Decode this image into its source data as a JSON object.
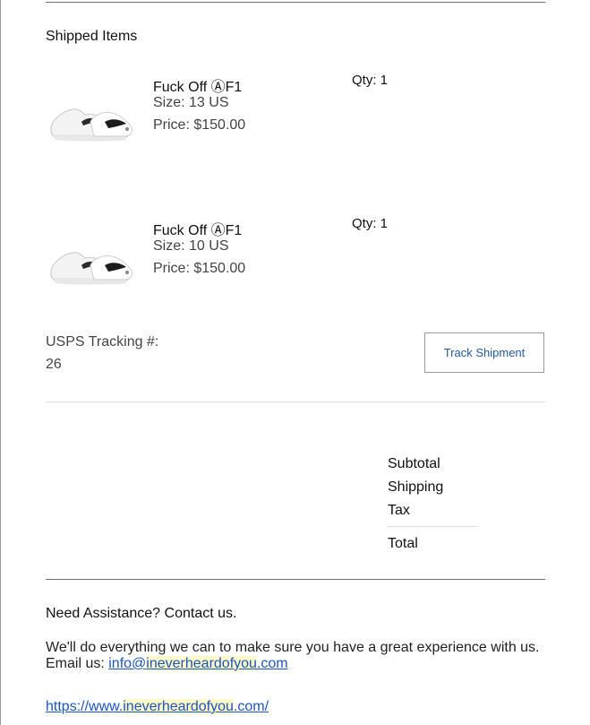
{
  "shipped": {
    "title": "Shipped Items",
    "items": [
      {
        "name": "Fuck Off ⒶF1",
        "size": "Size: 13 US",
        "price": "Price: $150.00",
        "qty": "Qty: 1",
        "image_icon": "sneaker-image"
      },
      {
        "name": "Fuck Off ⒶF1",
        "size": "Size: 10 US",
        "price": "Price: $150.00",
        "qty": "Qty: 1",
        "image_icon": "sneaker-image"
      }
    ]
  },
  "tracking": {
    "label": "USPS Tracking #:",
    "number": "26",
    "button_label": "Track Shipment"
  },
  "summary": {
    "subtotal_label": "Subtotal",
    "shipping_label": "Shipping",
    "tax_label": "Tax",
    "total_label": "Total"
  },
  "assistance": {
    "title": "Need Assistance? Contact us.",
    "body": "We'll do everything we can to make sure you have a great experience with us.",
    "email_prefix": "Email us: ",
    "email_part1": "info@",
    "email_part2": "ineverheardofyou",
    "email_part3": ".com",
    "website_part1": "https://www.",
    "website_part2": "ineverheardofyou",
    "website_part3": ".com/"
  },
  "colors": {
    "link": "#1a56c6",
    "button_text": "#1f5aa6",
    "highlight": "#fbf7c6"
  }
}
